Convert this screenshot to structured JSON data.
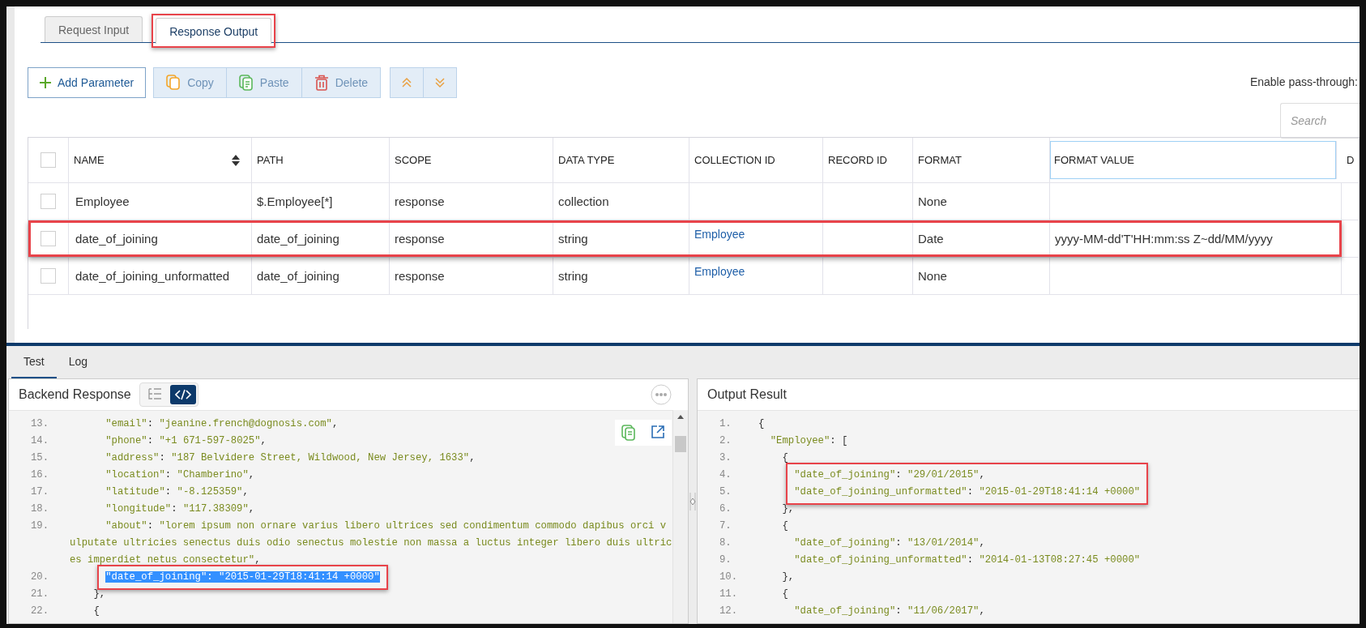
{
  "tabs": [
    {
      "label": "Request Input",
      "selected": false,
      "annotated": false
    },
    {
      "label": "Response Output",
      "selected": true,
      "annotated": true
    }
  ],
  "toolbar": {
    "add_button": "Add Parameter",
    "actions": [
      {
        "label": "Copy",
        "kind": "copy",
        "disabled": true
      },
      {
        "label": "Paste",
        "kind": "paste",
        "disabled": true
      },
      {
        "label": "Delete",
        "kind": "delete",
        "disabled": true
      }
    ],
    "move_buttons": [
      {
        "kind": "up"
      },
      {
        "kind": "down"
      }
    ]
  },
  "pass_through_label": "Enable pass-through:",
  "search": {
    "placeholder": "Search"
  },
  "table": {
    "all_checked": false,
    "columns": [
      {
        "label": "NAME",
        "sortable": true,
        "focused": false,
        "kind": "text"
      },
      {
        "label": "PATH",
        "sortable": false,
        "focused": false,
        "kind": "text"
      },
      {
        "label": "SCOPE",
        "sortable": false,
        "focused": false,
        "kind": "text"
      },
      {
        "label": "DATA TYPE",
        "sortable": false,
        "focused": false,
        "kind": "text"
      },
      {
        "label": "COLLECTION ID",
        "sortable": false,
        "focused": false,
        "kind": "link"
      },
      {
        "label": "RECORD ID",
        "sortable": false,
        "focused": false,
        "kind": "text"
      },
      {
        "label": "FORMAT",
        "sortable": false,
        "focused": false,
        "kind": "text"
      },
      {
        "label": "FORMAT VALUE",
        "sortable": false,
        "focused": true,
        "kind": "text"
      },
      {
        "label": "D",
        "sortable": false,
        "focused": false,
        "kind": "text"
      }
    ],
    "rows": [
      {
        "checked": false,
        "annotated": false,
        "cells": [
          "Employee",
          "$.Employee[*]",
          "response",
          "collection",
          "",
          "",
          "None",
          "",
          ""
        ]
      },
      {
        "checked": false,
        "annotated": true,
        "cells": [
          "date_of_joining",
          "date_of_joining",
          "response",
          "string",
          "Employee",
          "",
          "Date",
          "yyyy-MM-dd'T'HH:mm:ss Z~dd/MM/yyyy",
          ""
        ]
      },
      {
        "checked": false,
        "annotated": false,
        "cells": [
          "date_of_joining_unformatted",
          "date_of_joining",
          "response",
          "string",
          "Employee",
          "",
          "None",
          "",
          ""
        ]
      }
    ]
  },
  "bottom_tabs": [
    {
      "label": "Test",
      "selected": true
    },
    {
      "label": "Log",
      "selected": false
    }
  ],
  "backend": {
    "title": "Backend Response",
    "view_modes": [
      {
        "kind": "tree",
        "selected": false
      },
      {
        "kind": "code",
        "selected": true
      }
    ],
    "lines": [
      {
        "number": "13.",
        "text": "      \"email\": \"jeanine.french@dognosis.com\",",
        "selected": false,
        "annotated": false
      },
      {
        "number": "14.",
        "text": "      \"phone\": \"+1 671-597-8025\",",
        "selected": false,
        "annotated": false
      },
      {
        "number": "15.",
        "text": "      \"address\": \"187 Belvidere Street, Wildwood, New Jersey, 1633\",",
        "selected": false,
        "annotated": false
      },
      {
        "number": "16.",
        "text": "      \"location\": \"Chamberino\",",
        "selected": false,
        "annotated": false
      },
      {
        "number": "17.",
        "text": "      \"latitude\": \"-8.125359\",",
        "selected": false,
        "annotated": false
      },
      {
        "number": "18.",
        "text": "      \"longitude\": \"117.38309\",",
        "selected": false,
        "annotated": false
      },
      {
        "number": "19.",
        "text": "      \"about\": \"lorem ipsum non ornare varius libero ultrices sed condimentum commodo dapibus orci vulputate ultricies senectus duis odio senectus molestie non massa a luctus integer libero duis ultrices imperdiet netus consectetur\",",
        "selected": false,
        "annotated": false
      },
      {
        "number": "20.",
        "text": "      \"date_of_joining\": \"2015-01-29T18:41:14 +0000\"",
        "selected": true,
        "annotated": true
      },
      {
        "number": "21.",
        "text": "    },",
        "selected": false,
        "annotated": false
      },
      {
        "number": "22.",
        "text": "    {",
        "selected": false,
        "annotated": false
      }
    ]
  },
  "output": {
    "title": "Output Result",
    "lines": [
      {
        "number": "1.",
        "text": "{",
        "annotated": false
      },
      {
        "number": "2.",
        "text": "  \"Employee\": [",
        "annotated": false
      },
      {
        "number": "3.",
        "text": "    {",
        "annotated": false
      },
      {
        "number": "4.",
        "text": "      \"date_of_joining\": \"29/01/2015\",",
        "annotated": true
      },
      {
        "number": "5.",
        "text": "      \"date_of_joining_unformatted\": \"2015-01-29T18:41:14 +0000\"",
        "annotated": true
      },
      {
        "number": "6.",
        "text": "    },",
        "annotated": false
      },
      {
        "number": "7.",
        "text": "    {",
        "annotated": false
      },
      {
        "number": "8.",
        "text": "      \"date_of_joining\": \"13/01/2014\",",
        "annotated": false
      },
      {
        "number": "9.",
        "text": "      \"date_of_joining_unformatted\": \"2014-01-13T08:27:45 +0000\"",
        "annotated": false
      },
      {
        "number": "10.",
        "text": "    },",
        "annotated": false
      },
      {
        "number": "11.",
        "text": "    {",
        "annotated": false
      },
      {
        "number": "12.",
        "text": "      \"date_of_joining\": \"11/06/2017\",",
        "annotated": false
      }
    ]
  }
}
